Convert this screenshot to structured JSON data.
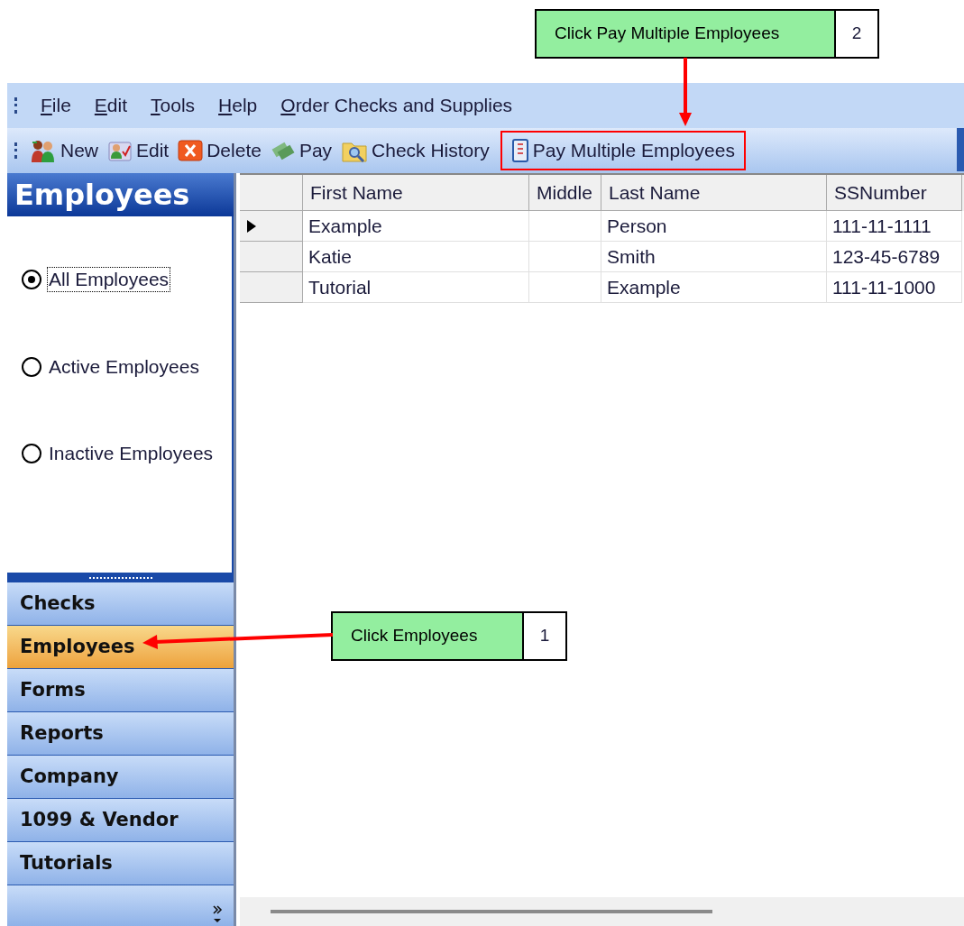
{
  "callouts": [
    {
      "text": "Click Pay Multiple Employees",
      "number": "2"
    },
    {
      "text": "Click Employees",
      "number": "1"
    }
  ],
  "menu": [
    {
      "key": "F",
      "rest": "ile"
    },
    {
      "key": "E",
      "rest": "dit"
    },
    {
      "key": "T",
      "rest": "ools"
    },
    {
      "key": "H",
      "rest": "elp"
    },
    {
      "key": "O",
      "rest": "rder Checks and Supplies"
    }
  ],
  "toolbar": [
    {
      "kind": "new",
      "label": "New",
      "highlighted": false
    },
    {
      "kind": "edit",
      "label": "Edit",
      "highlighted": false
    },
    {
      "kind": "delete",
      "label": "Delete",
      "highlighted": false
    },
    {
      "kind": "pay",
      "label": "Pay",
      "highlighted": false
    },
    {
      "kind": "history",
      "label": "Check History",
      "highlighted": false
    },
    {
      "kind": "multiple",
      "label": "Pay Multiple Employees",
      "highlighted": true
    }
  ],
  "sidebar": {
    "title": "Employees",
    "filters": [
      {
        "label": "All Employees",
        "selected": true
      },
      {
        "label": "Active Employees",
        "selected": false
      },
      {
        "label": "Inactive Employees",
        "selected": false
      }
    ],
    "sections": [
      {
        "label": "Checks",
        "selected": false
      },
      {
        "label": "Employees",
        "selected": true
      },
      {
        "label": "Forms",
        "selected": false
      },
      {
        "label": "Reports",
        "selected": false
      },
      {
        "label": "Company",
        "selected": false
      },
      {
        "label": "1099 & Vendor",
        "selected": false
      },
      {
        "label": "Tutorials",
        "selected": false
      }
    ]
  },
  "table": {
    "columns": [
      "First Name",
      "Middle",
      "Last Name",
      "SSNumber"
    ],
    "rows": [
      {
        "cells": [
          "Example",
          "",
          "Person",
          "111-11-1111"
        ],
        "current": true
      },
      {
        "cells": [
          "Katie",
          "",
          "Smith",
          "123-45-6789"
        ],
        "current": false
      },
      {
        "cells": [
          "Tutorial",
          "",
          "Example",
          "111-11-1000"
        ],
        "current": false
      }
    ]
  }
}
